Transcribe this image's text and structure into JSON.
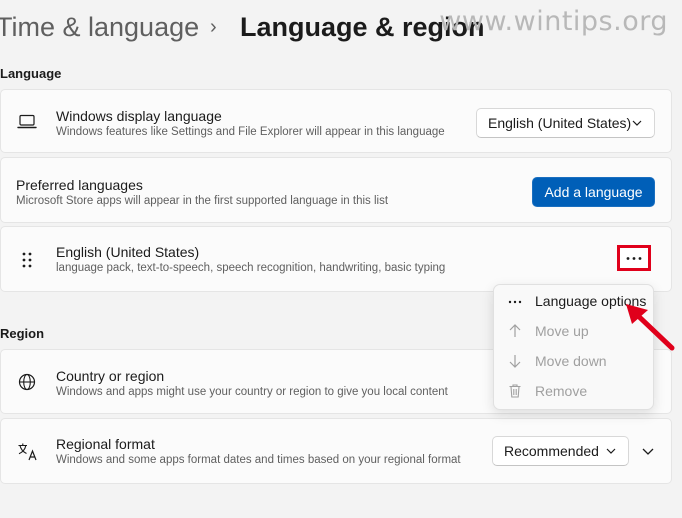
{
  "header": {
    "parent": "Time & language",
    "separator": "›",
    "title": "Language & region",
    "watermark": "www.wintips.org"
  },
  "language_section": {
    "heading": "Language",
    "display_language": {
      "title": "Windows display language",
      "subtitle": "Windows features like Settings and File Explorer will appear in this language",
      "value": "English (United States)"
    },
    "preferred": {
      "title": "Preferred languages",
      "subtitle": "Microsoft Store apps will appear in the first supported language in this list",
      "button_label": "Add a language"
    },
    "language_item": {
      "title": "English (United States)",
      "subtitle": "language pack, text-to-speech, speech recognition, handwriting, basic typing",
      "more_label": "···"
    }
  },
  "context_menu": {
    "items": [
      {
        "label": "Language options",
        "enabled": true
      },
      {
        "label": "Move up",
        "enabled": false
      },
      {
        "label": "Move down",
        "enabled": false
      },
      {
        "label": "Remove",
        "enabled": false
      }
    ]
  },
  "region_section": {
    "heading": "Region",
    "country": {
      "title": "Country or region",
      "subtitle": "Windows and apps might use your country or region to give you local content"
    },
    "format": {
      "title": "Regional format",
      "subtitle": "Windows and some apps format dates and times based on your regional format",
      "value": "Recommended"
    }
  },
  "colors": {
    "accent": "#005fb8",
    "highlight": "#e0001b"
  }
}
